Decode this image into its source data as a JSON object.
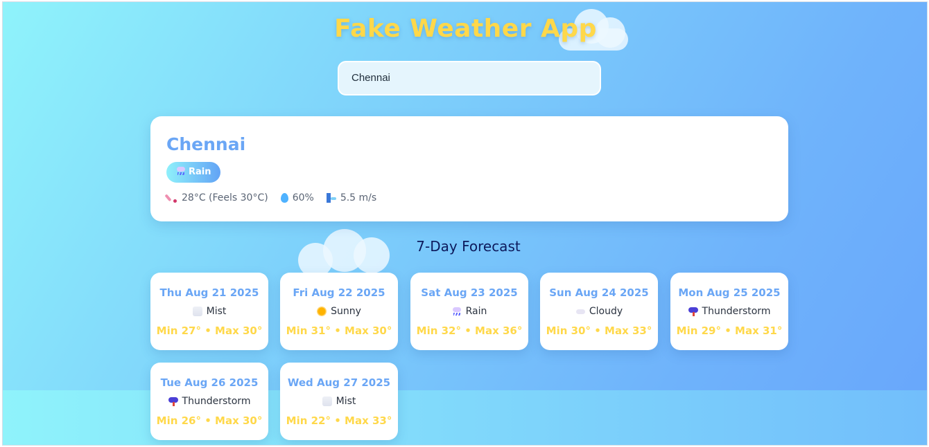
{
  "app": {
    "title": "Fake Weather App"
  },
  "search": {
    "value": "Chennai"
  },
  "current": {
    "city": "Chennai",
    "condition": "Rain",
    "condition_icon": "rain-icon",
    "temperature": "28°C (Feels 30°C)",
    "humidity": "60%",
    "wind": "5.5 m/s"
  },
  "forecast": {
    "title": "7-Day Forecast",
    "days": [
      {
        "date": "Thu Aug 21 2025",
        "condition": "Mist",
        "icon": "mist-icon",
        "temps": "Min 27° • Max 30°"
      },
      {
        "date": "Fri Aug 22 2025",
        "condition": "Sunny",
        "icon": "sun-icon",
        "temps": "Min 31° • Max 30°"
      },
      {
        "date": "Sat Aug 23 2025",
        "condition": "Rain",
        "icon": "rain-icon",
        "temps": "Min 32° • Max 36°"
      },
      {
        "date": "Sun Aug 24 2025",
        "condition": "Cloudy",
        "icon": "cloud-icon",
        "temps": "Min 30° • Max 33°"
      },
      {
        "date": "Mon Aug 25 2025",
        "condition": "Thunderstorm",
        "icon": "thunderstorm-icon",
        "temps": "Min 29° • Max 31°"
      },
      {
        "date": "Tue Aug 26 2025",
        "condition": "Thunderstorm",
        "icon": "thunderstorm-icon",
        "temps": "Min 26° • Max 30°"
      },
      {
        "date": "Wed Aug 27 2025",
        "condition": "Mist",
        "icon": "mist-icon",
        "temps": "Min 22° • Max 33°"
      }
    ]
  },
  "colors": {
    "accent": "#6aa6f5",
    "title": "#ffd84a",
    "heading": "#0d1a5c"
  }
}
